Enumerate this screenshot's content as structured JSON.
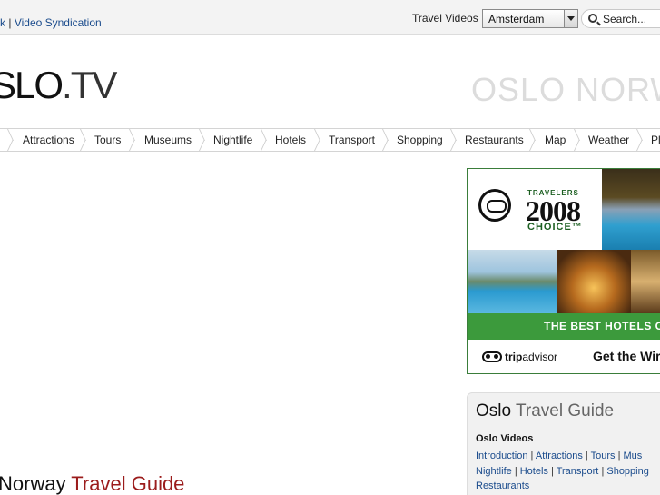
{
  "topbar": {
    "link_fragment": "k",
    "divider": "|",
    "link_video_syndication": "Video Syndication",
    "travel_videos_label": "Travel Videos",
    "city_select_value": "Amsterdam",
    "search_placeholder": "Search..."
  },
  "logo": {
    "part1": "SLO",
    "part2": ".TV"
  },
  "banner_text": "OSLO NORW",
  "nav": {
    "items": [
      "Attractions",
      "Tours",
      "Museums",
      "Nightlife",
      "Hotels",
      "Transport",
      "Shopping",
      "Restaurants",
      "Map",
      "Weather",
      "Pl"
    ]
  },
  "ad": {
    "travelers": "TRAVELERS",
    "year": "2008",
    "choice": "CHOICE™",
    "banner": "THE BEST HOTELS O",
    "brand_a": "trip",
    "brand_b": "advisor",
    "cta": "Get the Wir"
  },
  "guide": {
    "title_a": "Oslo",
    "title_b": "Travel Guide",
    "subtitle": "Oslo Videos",
    "links_row1": [
      "Introduction",
      "Attractions",
      "Tours",
      "Mus"
    ],
    "links_row2": [
      "Nightlife",
      "Hotels",
      "Transport",
      "Shopping"
    ],
    "links_row3": [
      "Restaurants"
    ],
    "sep": "|"
  },
  "page_heading": {
    "a": "Norway",
    "b": "Travel Guide"
  }
}
